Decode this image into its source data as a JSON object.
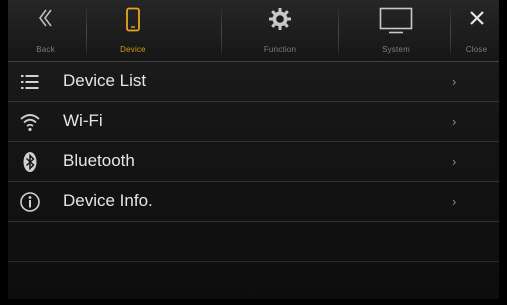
{
  "tabs": {
    "back": "Back",
    "device": "Device",
    "function": "Function",
    "system": "System",
    "close": "Close"
  },
  "colors": {
    "active": "#d89a1c",
    "inactive": "#7d7d7d"
  },
  "list": [
    {
      "label": "Device List",
      "icon": "list-icon"
    },
    {
      "label": "Wi-Fi",
      "icon": "wifi-icon"
    },
    {
      "label": "Bluetooth",
      "icon": "bluetooth-icon"
    },
    {
      "label": "Device Info.",
      "icon": "info-icon"
    }
  ],
  "chevron": "›"
}
